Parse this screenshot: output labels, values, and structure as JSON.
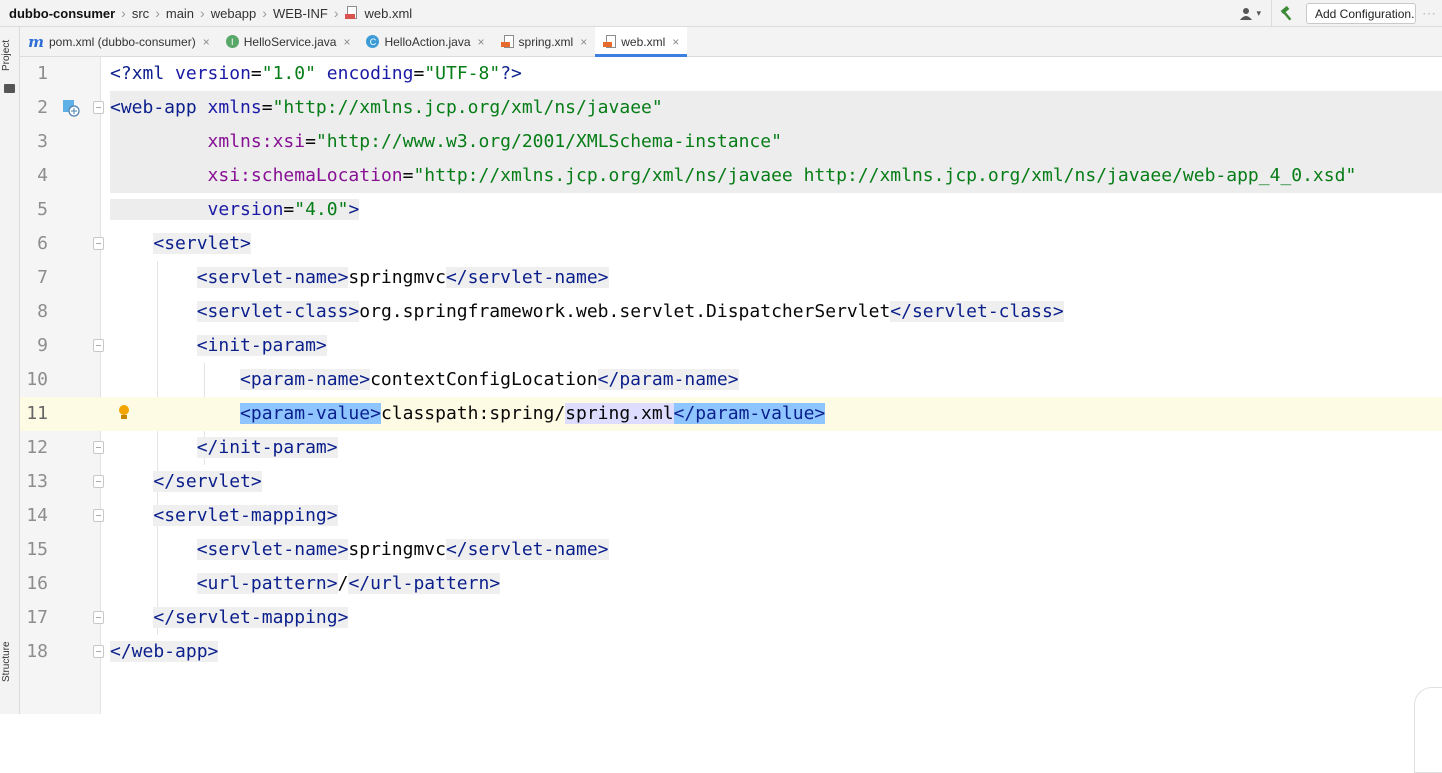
{
  "breadcrumb": {
    "items": [
      "dubbo-consumer",
      "src",
      "main",
      "webapp",
      "WEB-INF",
      "web.xml"
    ],
    "separator": "›"
  },
  "toolbar": {
    "user_icon": "user-icon",
    "build_icon": "hammer-icon",
    "run_config_label": "Add Configuration..."
  },
  "tool_windows": {
    "left_top": "Project",
    "left_bottom": "Structure"
  },
  "tabs": [
    {
      "label": "pom.xml (dubbo-consumer)",
      "icon": "maven-icon",
      "active": false
    },
    {
      "label": "HelloService.java",
      "icon": "interface-icon",
      "active": false
    },
    {
      "label": "HelloAction.java",
      "icon": "class-icon",
      "active": false
    },
    {
      "label": "spring.xml",
      "icon": "xml-file-icon",
      "active": false
    },
    {
      "label": "web.xml",
      "icon": "xml-file-icon",
      "active": true
    }
  ],
  "tab_close_glyph": "×",
  "editor": {
    "current_line": 11,
    "lines": [
      {
        "n": "1"
      },
      {
        "n": "2"
      },
      {
        "n": "3"
      },
      {
        "n": "4"
      },
      {
        "n": "5"
      },
      {
        "n": "6"
      },
      {
        "n": "7"
      },
      {
        "n": "8"
      },
      {
        "n": "9"
      },
      {
        "n": "10"
      },
      {
        "n": "11"
      },
      {
        "n": "12"
      },
      {
        "n": "13"
      },
      {
        "n": "14"
      },
      {
        "n": "15"
      },
      {
        "n": "16"
      },
      {
        "n": "17"
      },
      {
        "n": "18"
      }
    ],
    "tokens": {
      "l1_a": "<?",
      "l1_b": "xml ",
      "l1_c": "version",
      "l1_d": "=",
      "l1_e": "\"1.0\"",
      "l1_f": " ",
      "l1_g": "encoding",
      "l1_h": "=",
      "l1_i": "\"UTF-8\"",
      "l1_j": "?>",
      "l2_a": "<web-app ",
      "l2_b": "xmlns",
      "l2_c": "=",
      "l2_d": "\"http://xmlns.jcp.org/xml/ns/javaee\"",
      "l3_a": "xmlns:xsi",
      "l3_b": "=",
      "l3_c": "\"http://www.w3.org/2001/XMLSchema-instance\"",
      "l4_a": "xsi:schemaLocation",
      "l4_b": "=",
      "l4_c": "\"http://xmlns.jcp.org/xml/ns/javaee http://xmlns.jcp.org/xml/ns/javaee/web-app_4_0.xsd\"",
      "l5_a": "version",
      "l5_b": "=",
      "l5_c": "\"4.0\"",
      "l5_d": ">",
      "l6": "<servlet>",
      "l7_a": "<servlet-name>",
      "l7_b": "springmvc",
      "l7_c": "</servlet-name>",
      "l8_a": "<servlet-class>",
      "l8_b": "org.springframework.web.servlet.DispatcherServlet",
      "l8_c": "</servlet-class>",
      "l9": "<init-param>",
      "l10_a": "<param-name>",
      "l10_b": "contextConfigLocation",
      "l10_c": "</param-name>",
      "l11_a": "<param-value>",
      "l11_b": "classpath:spring/",
      "l11_c": "spring.xml",
      "l11_d": "</param-value>",
      "l12": "</init-param>",
      "l13": "</servlet>",
      "l14": "<servlet-mapping>",
      "l15_a": "<servlet-name>",
      "l15_b": "springmvc",
      "l15_c": "</servlet-name>",
      "l16_a": "<url-pattern>",
      "l16_b": "/",
      "l16_c": "</url-pattern>",
      "l17": "</servlet-mapping>",
      "l18": "</web-app>"
    }
  },
  "colors": {
    "accent": "#3d7fe0",
    "tag": "#0b1f8c",
    "string": "#067d17",
    "namespace_attr": "#871094",
    "current_line": "#fefbe4",
    "selection": "#8ec5ff"
  }
}
